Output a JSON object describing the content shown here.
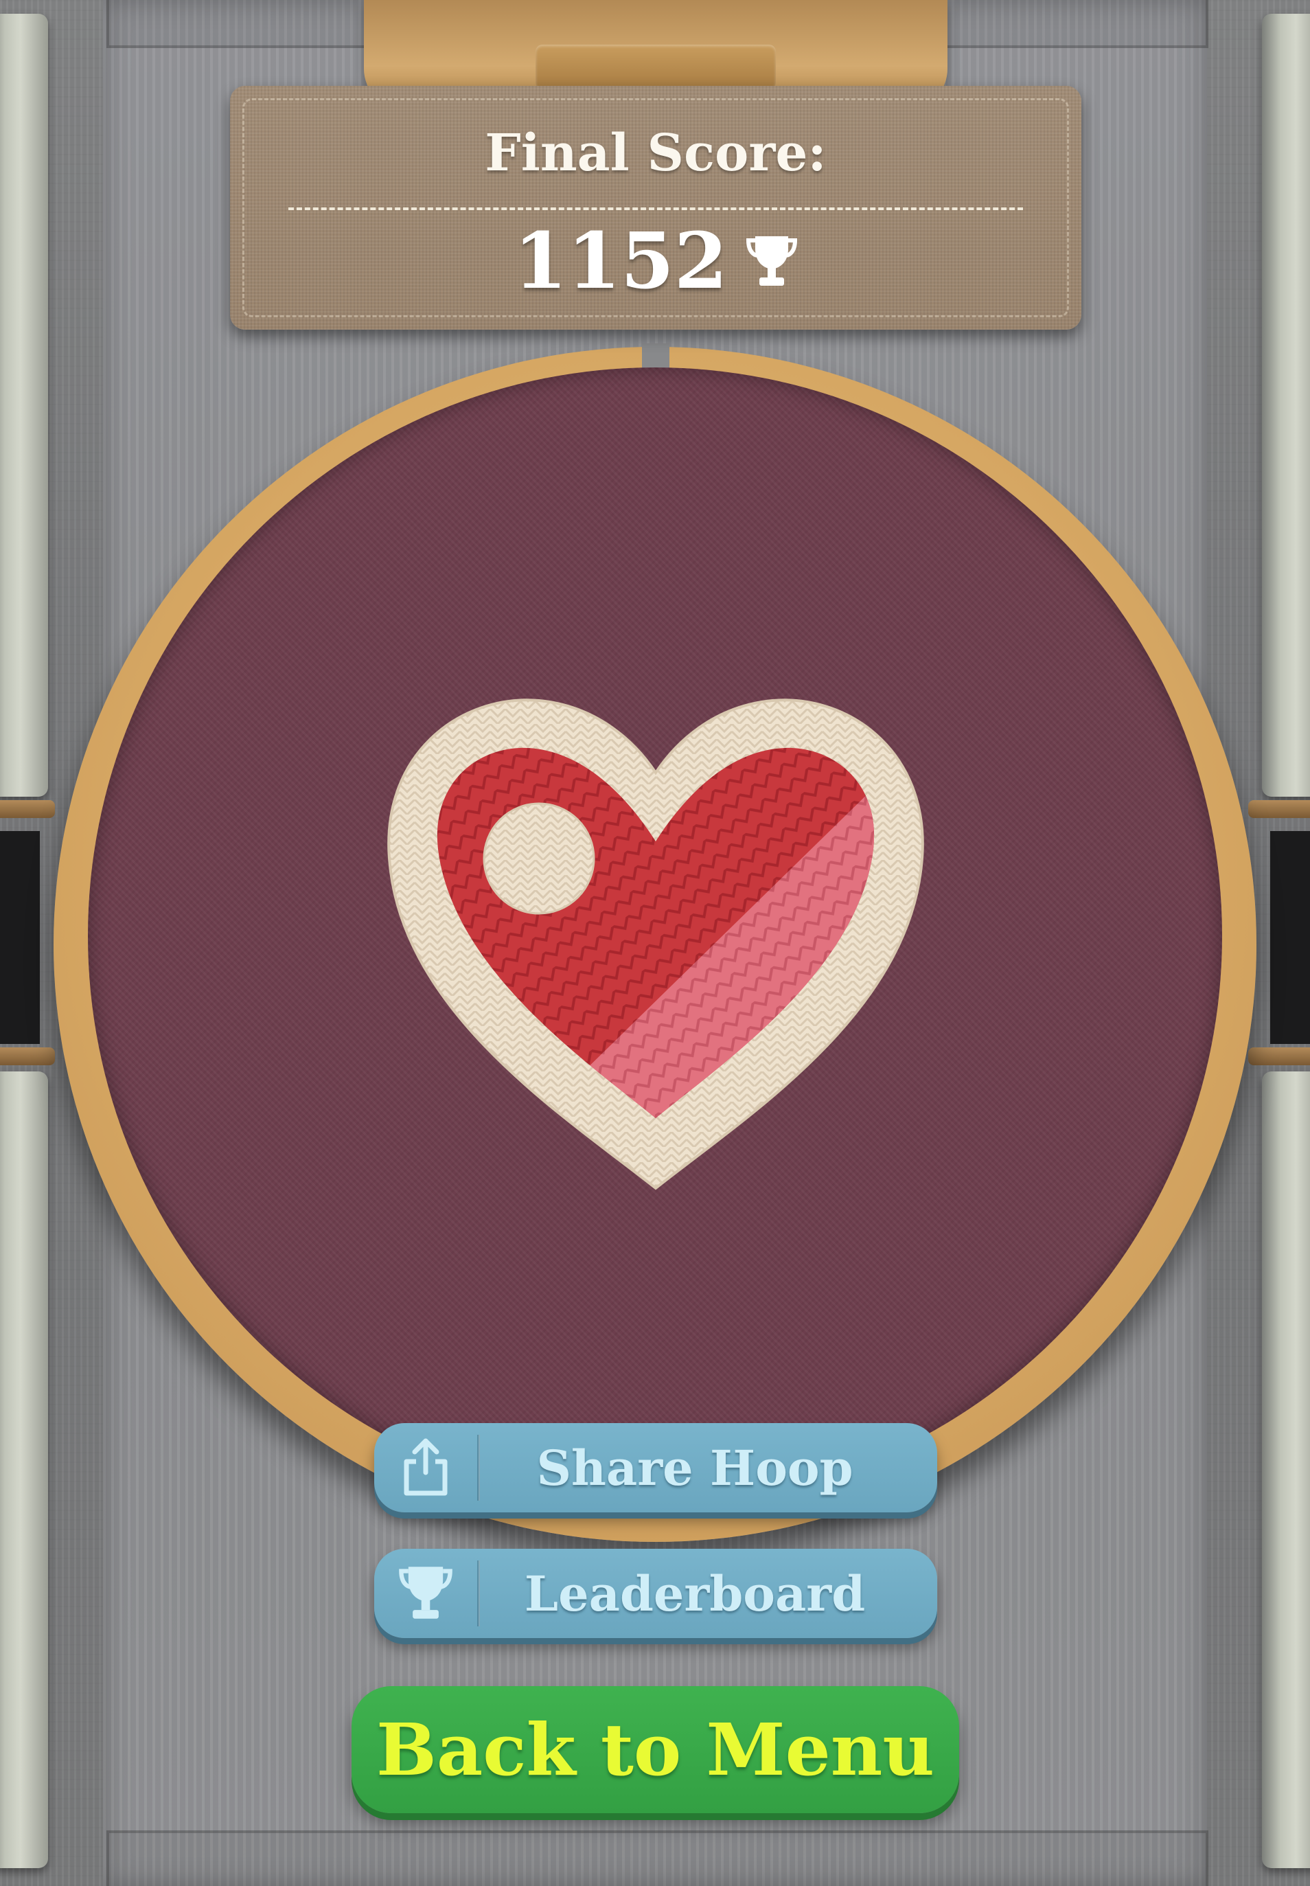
{
  "score_panel": {
    "title": "Final Score:",
    "score": "1152",
    "icon": "trophy-icon"
  },
  "hoop": {
    "design": "heart-design",
    "colors": {
      "fabric": "#6d3e4d",
      "hoop_wood": "#d6a763",
      "heart_outline": "#efe3cf",
      "heart_red": "#c8383d",
      "heart_pink": "#e2727f"
    }
  },
  "actions": {
    "share_label": "Share Hoop",
    "share_icon": "share-icon",
    "leaderboard_label": "Leaderboard",
    "leaderboard_icon": "trophy-icon",
    "menu_label": "Back to Menu"
  },
  "colors": {
    "secondary_button": "#6aa6bf",
    "secondary_text": "#cfeef8",
    "primary_button": "#37a647",
    "primary_text": "#e8fb34",
    "plaque": "#9e8871"
  }
}
